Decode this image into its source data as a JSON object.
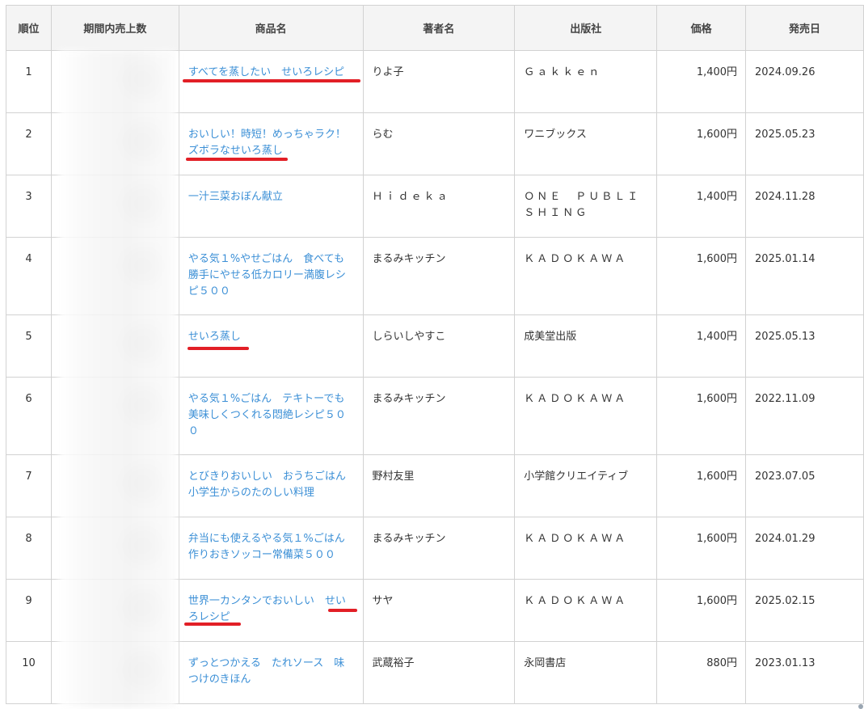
{
  "headers": {
    "rank": "順位",
    "sales": "期間内売上数",
    "title": "商品名",
    "author": "著者名",
    "publisher": "出版社",
    "price": "価格",
    "date": "発売日"
  },
  "rows": [
    {
      "rank": "1",
      "title": "すべてを蒸したい　せいろレシピ",
      "author": "りよ子",
      "publisher": "Ｇａｋｋｅｎ",
      "price": "1,400円",
      "date": "2024.09.26"
    },
    {
      "rank": "2",
      "title": "おいしい！時短！めっちゃラク！ズボラなせいろ蒸し",
      "author": "らむ",
      "publisher": "ワニブックス",
      "price": "1,600円",
      "date": "2025.05.23"
    },
    {
      "rank": "3",
      "title": "一汁三菜おぼん献立",
      "author": "Ｈｉｄｅｋａ",
      "publisher": "ＯＮＥ　ＰＵＢＬＩＳＨＩＮＧ",
      "price": "1,400円",
      "date": "2024.11.28"
    },
    {
      "rank": "4",
      "title": "やる気１%やせごはん　食べても勝手にやせる低カロリー満腹レシピ５００",
      "author": "まるみキッチン",
      "publisher": "ＫＡＤＯＫＡＷＡ",
      "price": "1,600円",
      "date": "2025.01.14"
    },
    {
      "rank": "5",
      "title": "せいろ蒸し",
      "author": "しらいしやすこ",
      "publisher": "成美堂出版",
      "price": "1,400円",
      "date": "2025.05.13"
    },
    {
      "rank": "6",
      "title": "やる気１%ごはん　テキトーでも美味しくつくれる悶絶レシピ５００",
      "author": "まるみキッチン",
      "publisher": "ＫＡＤＯＫＡＷＡ",
      "price": "1,600円",
      "date": "2022.11.09"
    },
    {
      "rank": "7",
      "title": "とびきりおいしい　おうちごはん小学生からのたのしい料理",
      "author": "野村友里",
      "publisher": "小学館クリエイティブ",
      "price": "1,600円",
      "date": "2023.07.05"
    },
    {
      "rank": "8",
      "title": "弁当にも使えるやる気１%ごはん作りおきソッコー常備菜５００",
      "author": "まるみキッチン",
      "publisher": "ＫＡＤＯＫＡＷＡ",
      "price": "1,600円",
      "date": "2024.01.29"
    },
    {
      "rank": "9",
      "title": "世界一カンタンでおいしい　せいろレシピ",
      "author": "サヤ",
      "publisher": "ＫＡＤＯＫＡＷＡ",
      "price": "1,600円",
      "date": "2025.02.15"
    },
    {
      "rank": "10",
      "title": "ずっとつかえる　たれソース　味つけのきほん",
      "author": "武蔵裕子",
      "publisher": "永岡書店",
      "price": "880円",
      "date": "2023.01.13"
    }
  ],
  "colors": {
    "link": "#3b8fd6",
    "highlight_underline": "#e21f26",
    "header_bg": "#f4f4f4",
    "border": "#d2d2d2"
  }
}
